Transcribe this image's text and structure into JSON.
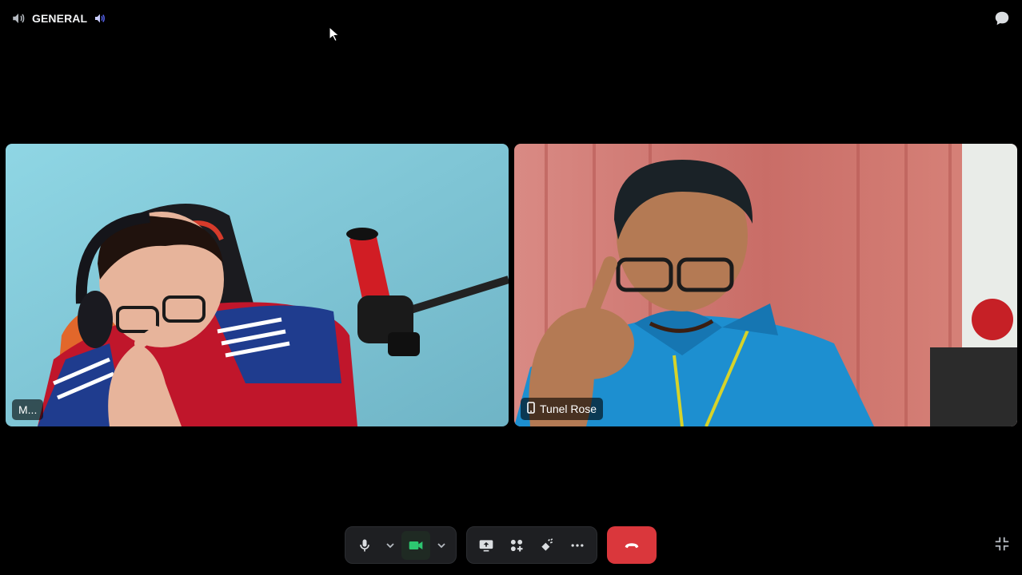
{
  "header": {
    "channel_name": "GENERAL",
    "speaker_icon": "speaker-icon",
    "voice_icon": "voice-volume-icon",
    "chat_icon": "chat-bubble-icon"
  },
  "participants": [
    {
      "display_name": "M...",
      "icon": null
    },
    {
      "display_name": "Tunel Rose",
      "icon": "mobile-phone-icon"
    }
  ],
  "controls": {
    "mic": {
      "icon": "microphone-icon",
      "options_icon": "chevron-down-icon"
    },
    "camera": {
      "icon": "video-camera-icon",
      "active": true,
      "options_icon": "chevron-down-icon"
    },
    "screen_share": {
      "icon": "screen-share-icon"
    },
    "activities": {
      "icon": "activities-icon"
    },
    "soundboard": {
      "icon": "soundboard-icon"
    },
    "more": {
      "icon": "more-dots-icon"
    },
    "leave": {
      "icon": "hang-up-icon"
    }
  },
  "colors": {
    "background": "#000000",
    "control_bg": "#1e1f22",
    "leave_red": "#da373c",
    "camera_active_green": "#2dc770"
  },
  "collapse_icon": "collapse-fullscreen-icon"
}
